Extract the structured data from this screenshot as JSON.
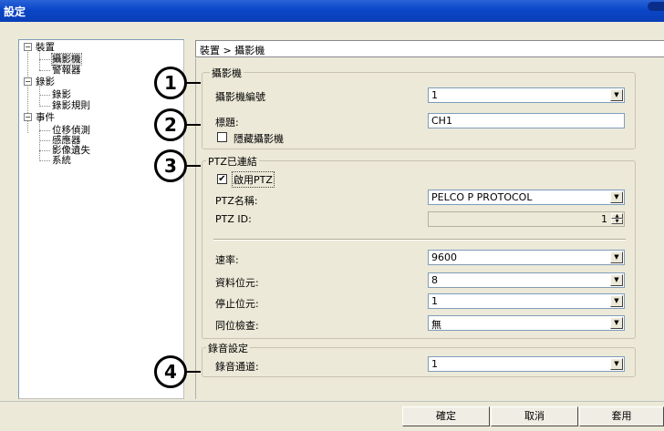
{
  "window": {
    "title": "設定"
  },
  "tree": {
    "items": [
      {
        "label": "裝置",
        "expander": "−"
      },
      {
        "label": "攝影機"
      },
      {
        "label": "警報器"
      },
      {
        "label": "錄影",
        "expander": "−"
      },
      {
        "label": "錄影"
      },
      {
        "label": "錄影規則"
      },
      {
        "label": "事件",
        "expander": "−"
      },
      {
        "label": "位移偵測"
      },
      {
        "label": "感應器"
      },
      {
        "label": "影像遺失"
      },
      {
        "label": "系統"
      }
    ]
  },
  "breadcrumb": "裝置 > 攝影機",
  "camera_group": {
    "title": "攝影機",
    "number_label": "攝影機編號",
    "number_value": "1",
    "title_label": "標題:",
    "title_value": "CH1",
    "hide_label": "隱藏攝影機",
    "hide_checked": false
  },
  "ptz_group": {
    "title": "PTZ已連結",
    "enable_label": "啟用PTZ",
    "enable_checked": true,
    "name_label": "PTZ名稱:",
    "name_value": "PELCO P PROTOCOL",
    "id_label": "PTZ ID:",
    "id_value": "1",
    "baud_label": "速率:",
    "baud_value": "9600",
    "databits_label": "資料位元:",
    "databits_value": "8",
    "stopbits_label": "停止位元:",
    "stopbits_value": "1",
    "parity_label": "同位檢查:",
    "parity_value": "無"
  },
  "audio_group": {
    "title": "錄音設定",
    "channel_label": "錄音通道:",
    "channel_value": "1"
  },
  "callouts": [
    "1",
    "2",
    "3",
    "4"
  ],
  "buttons": {
    "ok": "確定",
    "cancel": "取消",
    "apply": "套用"
  }
}
